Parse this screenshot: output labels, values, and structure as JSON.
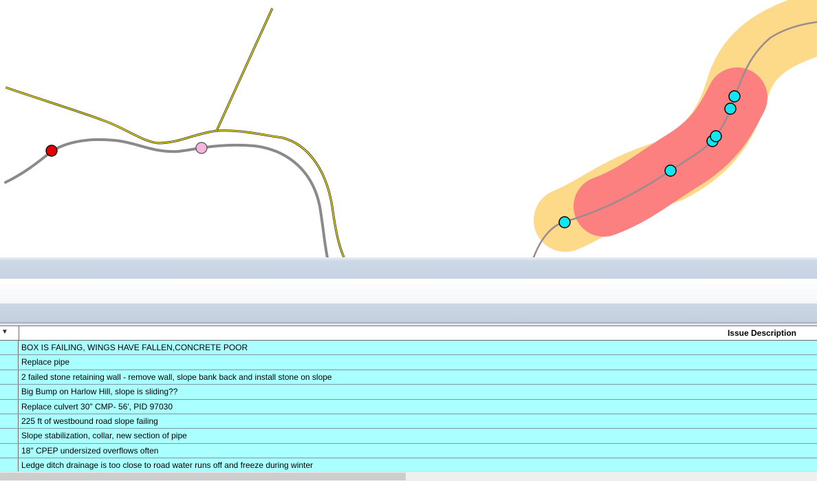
{
  "map": {
    "colors": {
      "road": "#8a8a8a",
      "boundary": "#f2e600",
      "buffer_outer": "#fdd98a",
      "buffer_inner": "#fc8080",
      "point_cyan": "#13e6f2",
      "point_red": "#e00000",
      "point_pink": "#f5b5e0"
    }
  },
  "grid": {
    "sort_icon": "sort-desc-icon",
    "header": {
      "issue_description": "Issue Description"
    },
    "rows": [
      "BOX IS FAILING, WINGS HAVE FALLEN,CONCRETE POOR",
      "Replace pipe",
      "2 failed stone retaining wall - remove wall, slope bank back and install stone on slope",
      "Big Bump on Harlow Hill, slope is sliding??",
      "Replace culvert  30\" CMP- 56', PID 97030",
      "225 ft of westbound road slope failing",
      "Slope stabilization, collar, new section of pipe",
      "18\" CPEP undersized overflows often",
      "Ledge ditch drainage is too close to road water runs off and freeze during winter"
    ],
    "row_color": "#aaffff"
  }
}
